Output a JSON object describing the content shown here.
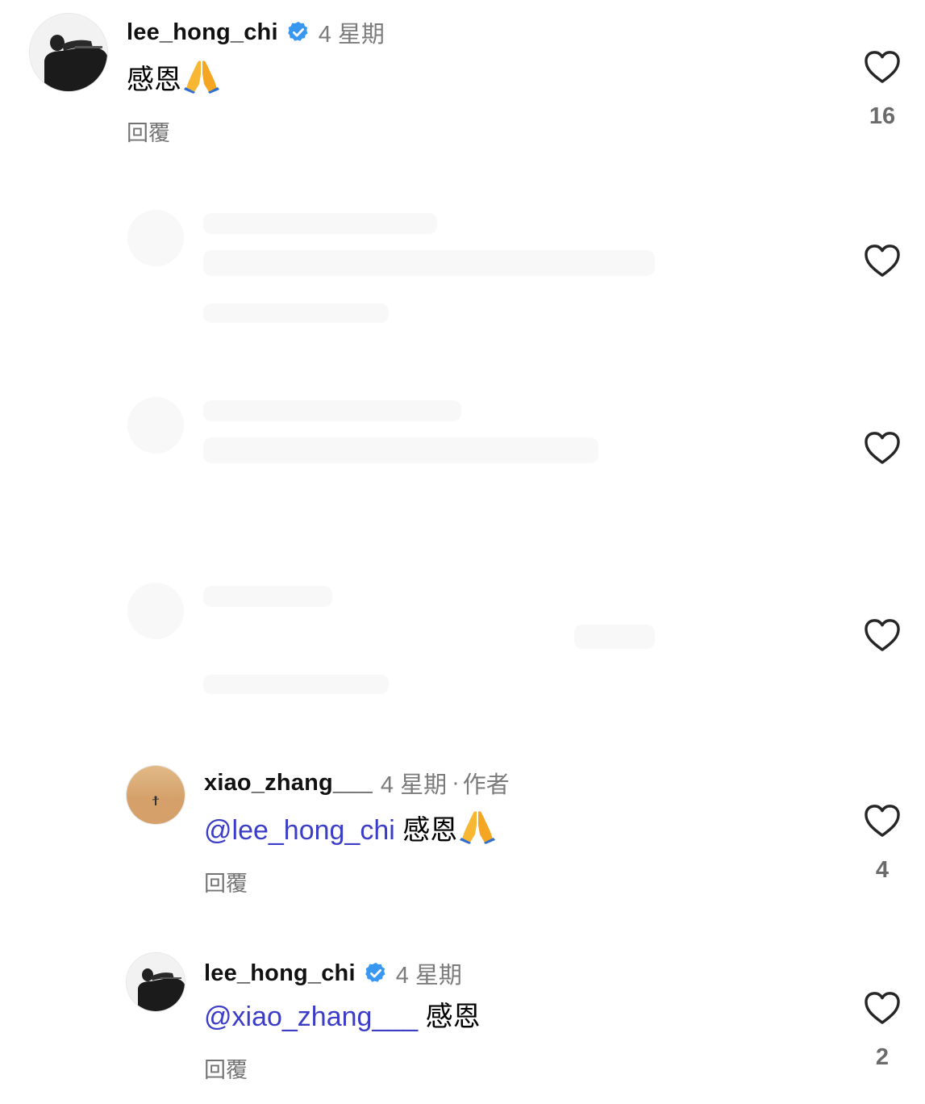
{
  "comments": [
    {
      "username": "lee_hong_chi",
      "verified": true,
      "time": "4 星期",
      "text": "感恩",
      "emoji": "folded-hands",
      "reply_label": "回覆",
      "likes": "16"
    },
    {
      "username": "xiao_zhang___",
      "verified": false,
      "time": "4 星期",
      "author_sep": "·",
      "author_label": "作者",
      "mention": "@lee_hong_chi",
      "text": "感恩",
      "emoji": "folded-hands",
      "reply_label": "回覆",
      "likes": "4"
    },
    {
      "username": "lee_hong_chi",
      "verified": true,
      "time": "4 星期",
      "mention": "@xiao_zhang___",
      "text": "感恩",
      "reply_label": "回覆",
      "likes": "2"
    }
  ],
  "icons": {
    "like": "heart-icon",
    "verified": "verified-badge-icon",
    "emoji": "folded-hands-emoji"
  },
  "colors": {
    "mention": "#3b3dc9",
    "verified": "#3897f0",
    "muted": "#7b7b7b"
  }
}
